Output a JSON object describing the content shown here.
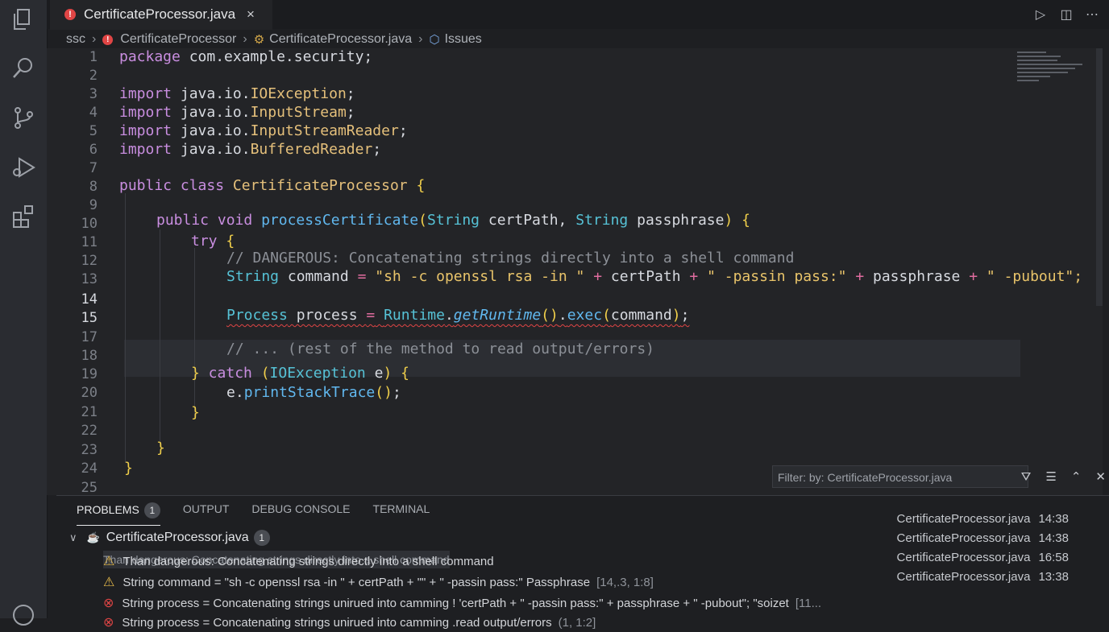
{
  "tab": {
    "title": "CertificateProcessor.java",
    "close": "×"
  },
  "breadcrumb": {
    "root": "ssc",
    "folder": "CertificateProcessor",
    "file": "CertificateProcessor.java",
    "symbol": "Issues"
  },
  "activity_icons": [
    "files-icon",
    "search-icon",
    "source-control-icon",
    "run-debug-icon",
    "extensions-icon"
  ],
  "editor": {
    "lines": [
      {
        "n": "1"
      },
      {
        "n": "2"
      },
      {
        "n": "3"
      },
      {
        "n": "4"
      },
      {
        "n": "5"
      },
      {
        "n": "6"
      },
      {
        "n": "7"
      },
      {
        "n": "8"
      },
      {
        "n": "9"
      },
      {
        "n": "10"
      },
      {
        "n": "11"
      },
      {
        "n": "12"
      },
      {
        "n": "13"
      },
      {
        "n": "14"
      },
      {
        "n": "15"
      },
      {
        "n": "17"
      },
      {
        "n": "18"
      },
      {
        "n": "19"
      },
      {
        "n": "20"
      },
      {
        "n": "21"
      },
      {
        "n": "22"
      },
      {
        "n": "23"
      },
      {
        "n": "24"
      },
      {
        "n": "25"
      }
    ],
    "current_line": "14",
    "code": {
      "l1": [
        "package",
        " com.example.security;"
      ],
      "l3": [
        "import",
        " java.io.",
        "IOException",
        ";"
      ],
      "l4": [
        "import",
        " java.io.",
        "InputStream",
        ";"
      ],
      "l5": [
        "import",
        " java.io.",
        "InputStreamReader",
        ";"
      ],
      "l6": [
        "import",
        " java.io.",
        "BufferedReader",
        ";"
      ],
      "l8": [
        "public class",
        " ",
        "CertificateProcessor",
        " {"
      ],
      "l10": [
        "public void",
        " ",
        "processCertificate",
        "(",
        "String",
        " certPath, ",
        "String",
        " passphrase",
        ")",
        " {"
      ],
      "l11": [
        "try",
        " {"
      ],
      "l12": "// DANGEROUS: Concatenating strings directly into a shell command",
      "l13": [
        "String",
        " command ",
        "=",
        " \"sh -c openssl rsa -in \" ",
        "+",
        " certPath ",
        "+",
        " \" -passin pass:\" ",
        "+",
        " passphrase ",
        "+",
        " \" -pubout\";"
      ],
      "l15": [
        "Process",
        " process ",
        "=",
        " ",
        "Runtime",
        ".",
        "getRuntime",
        "()",
        ".",
        "exec",
        "(",
        "command",
        ")",
        ";"
      ],
      "l18": "// ... (rest of the method to read output/errors)",
      "l19": [
        "}",
        " catch ",
        "(",
        "IOException",
        " e",
        ")",
        " {"
      ],
      "l20": [
        "e.",
        "printStackTrace",
        "()",
        ";"
      ],
      "l21": "}",
      "l23": "}",
      "l24": "}"
    }
  },
  "panel": {
    "tabs": [
      {
        "label": "PROBLEMS",
        "badge": "1"
      },
      {
        "label": "OUTPUT"
      },
      {
        "label": "DEBUG CONSOLE"
      },
      {
        "label": "TERMINAL"
      }
    ],
    "filter_placeholder": "Filter: by: CertificateProcessor.java",
    "file": {
      "name": "CertificateProcessor.java",
      "count": "1"
    },
    "problems": [
      {
        "severity": "warning",
        "text": "Than dangerous: Concatenating strings directly into a shell command",
        "position": "",
        "file": "CertificateProcessor.java",
        "time": "14:38"
      },
      {
        "severity": "warning",
        "text": "Than dangerous: Concatenating strings directly into a shell command",
        "position": "",
        "file": "CertificateProcessor.java",
        "time": "14:38"
      },
      {
        "severity": "warning",
        "text": "String command = \"sh -c openssl rsa -in \" + certPath + \"\" + \" -passin pass:\" Passphrase",
        "position": "[14,.3, 1:8]",
        "file": "CertificateProcessor.java",
        "time": "16:58"
      },
      {
        "severity": "error",
        "text": "String process = Concatenating strings unirued into camming ! 'certPath + \" -passin pass:\" + passphrase + \" -pubout\"; \"soizet",
        "position": "[11...",
        "file": "CertificateProcessor.java",
        "time": "13:38"
      },
      {
        "severity": "error",
        "text": "String process = Concatenating strings unirued into camming .read output/errors",
        "position": "(1, 1:2]",
        "file": "",
        "time": ""
      }
    ]
  },
  "colors": {
    "accent": "#61b8ef",
    "error": "#e04545",
    "warning": "#e5b94a"
  }
}
